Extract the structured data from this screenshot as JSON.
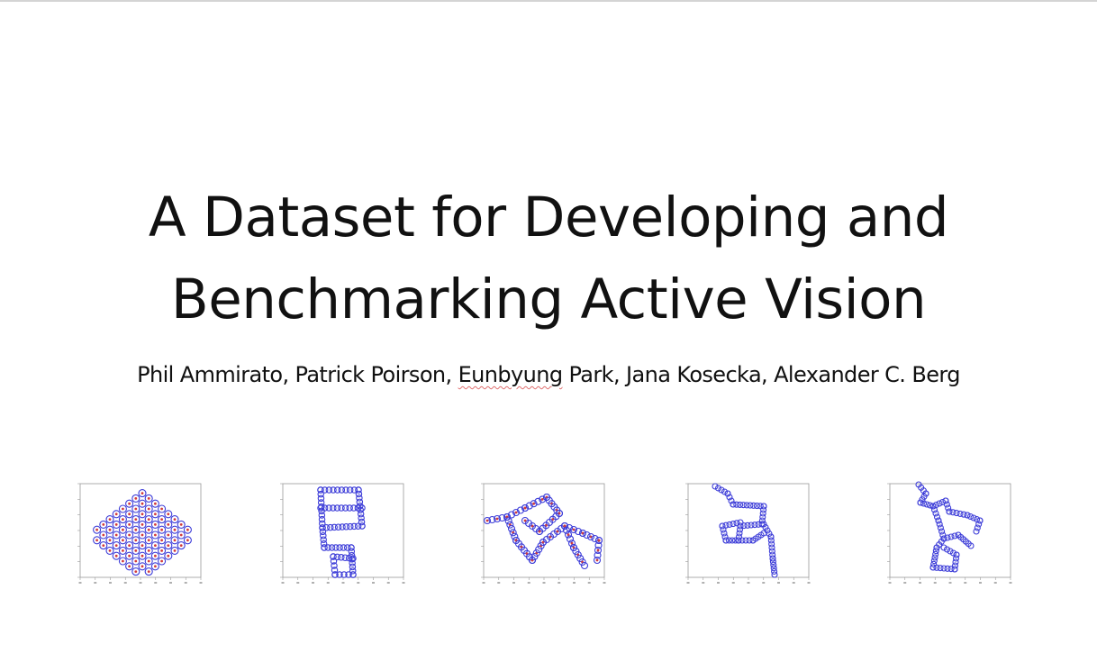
{
  "slide": {
    "title_line1": "A Dataset for Developing and",
    "title_line2": "Benchmarking Active Vision",
    "authors_part1": "Phil Ammirato, Patrick Poirson, ",
    "authors_flagged": "Eunbyung",
    "authors_part2": " Park, Jana Kosecka, Alexander C. Berg"
  },
  "thumbnails": [
    {
      "name": "scene-plot-1",
      "pattern": "diagonal-grid"
    },
    {
      "name": "scene-plot-2",
      "pattern": "double-loop"
    },
    {
      "name": "scene-plot-3",
      "pattern": "wide-loop"
    },
    {
      "name": "scene-plot-4",
      "pattern": "corridor"
    },
    {
      "name": "scene-plot-5",
      "pattern": "branching"
    }
  ],
  "colors": {
    "marker_blue": "#3d3dd8",
    "marker_red": "#d23b3b",
    "axis_gray": "#9a9a9a"
  }
}
